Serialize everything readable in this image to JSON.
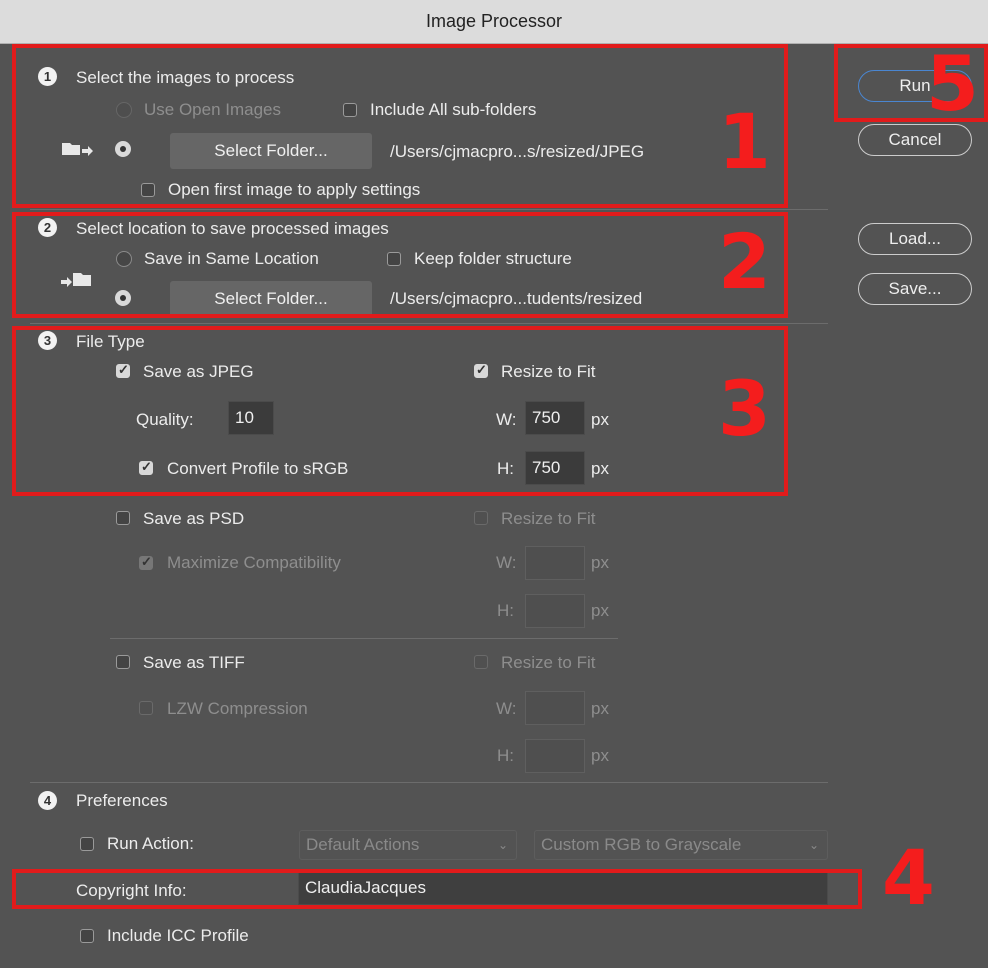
{
  "window": {
    "title": "Image Processor"
  },
  "section1": {
    "number": "1",
    "heading": "Select the images to process",
    "use_open_images": "Use Open Images",
    "include_subfolders": "Include All sub-folders",
    "select_folder": "Select Folder...",
    "path": "/Users/cjmacpro...s/resized/JPEG",
    "open_first": "Open first image to apply settings",
    "open_first_checked": false
  },
  "section2": {
    "number": "2",
    "heading": "Select location to save processed images",
    "same_location": "Save in Same Location",
    "keep_structure": "Keep folder structure",
    "select_folder": "Select Folder...",
    "path": "/Users/cjmacpro...tudents/resized"
  },
  "section3": {
    "number": "3",
    "heading": "File Type",
    "jpeg": {
      "label": "Save as JPEG",
      "checked": true,
      "quality_label": "Quality:",
      "quality": "10",
      "convert_label": "Convert Profile to sRGB",
      "convert_checked": true,
      "resize_label": "Resize to Fit",
      "resize_checked": true,
      "w_label": "W:",
      "w": "750",
      "h_label": "H:",
      "h": "750",
      "unit": "px"
    },
    "psd": {
      "label": "Save as PSD",
      "maximize_label": "Maximize Compatibility",
      "resize_label": "Resize to Fit",
      "w_label": "W:",
      "h_label": "H:",
      "unit": "px"
    },
    "tiff": {
      "label": "Save as TIFF",
      "lzw_label": "LZW Compression",
      "resize_label": "Resize to Fit",
      "w_label": "W:",
      "h_label": "H:",
      "unit": "px"
    }
  },
  "section4": {
    "number": "4",
    "heading": "Preferences",
    "run_action": "Run Action:",
    "action_set": "Default Actions",
    "action": "Custom RGB to Grayscale",
    "copyright_label": "Copyright Info:",
    "copyright_value": "ClaudiaJacques",
    "icc": "Include ICC Profile"
  },
  "buttons": {
    "run": "Run",
    "cancel": "Cancel",
    "load": "Load...",
    "save": "Save..."
  },
  "annotations": [
    "1",
    "2",
    "3",
    "4",
    "5"
  ],
  "colors": {
    "annotation": "#e11b1b",
    "default_button_border": "#4a86d1"
  }
}
